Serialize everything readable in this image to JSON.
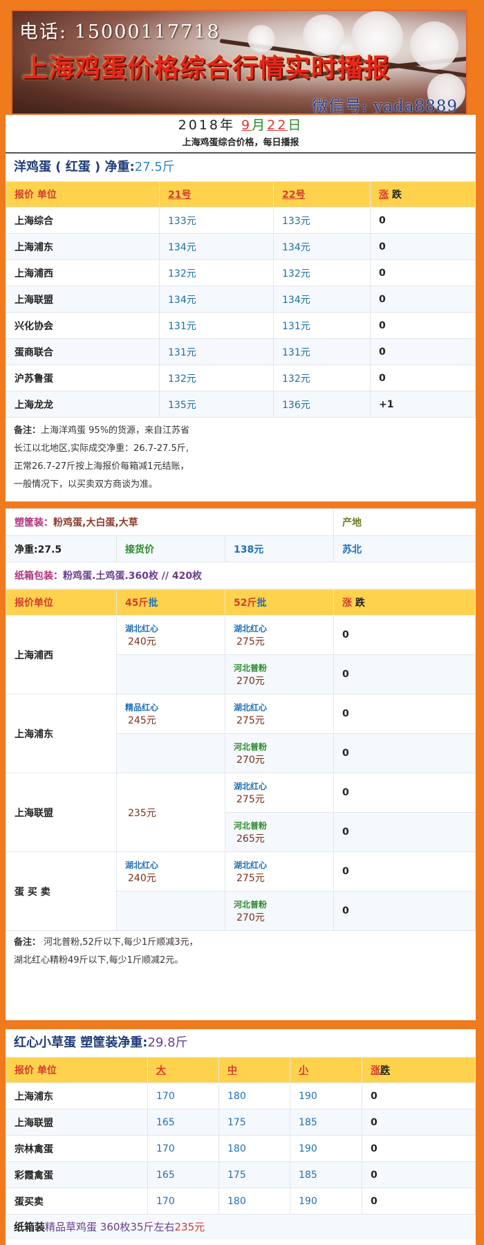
{
  "banner": {
    "phone": "电话: 15000117718",
    "title": "上海鸡蛋价格综合行情实时播报",
    "wechat": "微信号: yada8889"
  },
  "date": {
    "year": "2018",
    "year_unit": "年",
    "month": "9",
    "month_unit": "月",
    "day": "22",
    "day_unit": "日"
  },
  "subtitle": "上海鸡蛋综合价格，每日播报",
  "section1": {
    "title": "洋鸡蛋 ( 红蛋 ) 净重:",
    "weight": "27.5斤",
    "header": {
      "col1": "报价 单位",
      "col2": "21号",
      "col3": "22号",
      "col4a": "涨",
      "col4b": "跌"
    },
    "rows": [
      {
        "name": "上海综合",
        "d21": "133元",
        "d22": "133元",
        "chg": "0"
      },
      {
        "name": "上海浦东",
        "d21": "134元",
        "d22": "134元",
        "chg": "0"
      },
      {
        "name": "上海浦西",
        "d21": "132元",
        "d22": "132元",
        "chg": "0"
      },
      {
        "name": "上海联盟",
        "d21": "134元",
        "d22": "134元",
        "chg": "0"
      },
      {
        "name": "兴化协会",
        "d21": "131元",
        "d22": "131元",
        "chg": "0"
      },
      {
        "name": "蛋商联合",
        "d21": "131元",
        "d22": "131元",
        "chg": "0"
      },
      {
        "name": "沪苏鲁蛋",
        "d21": "132元",
        "d22": "132元",
        "chg": "0"
      },
      {
        "name": "上海龙龙",
        "d21": "135元",
        "d22": "136元",
        "chg": "+1"
      }
    ],
    "note_label": "备注：",
    "note_lines": [
      "上海洋鸡蛋 95%的货源，来自江苏省",
      "长江以北地区,实际成交净重：26.7-27.5斤,",
      "正常26.7-27斤按上海报价每箱减1元结账，",
      "一般情况下，以买卖双方商谈为准。"
    ]
  },
  "section2": {
    "label": "塑筐装：",
    "desc": "粉鸡蛋,大白蛋,大草",
    "origin_label": "产地",
    "weight": "净重:27.5",
    "price_label": "接货价",
    "price": "138元",
    "origin": "苏北",
    "carton_label": "纸箱包装：",
    "carton_desc": "粉鸡蛋.土鸡蛋.360枚 // 420枚",
    "header": {
      "col1": "报价单位",
      "col2": "45斤",
      "col2b": "批",
      "col3": "52斤",
      "col3b": "批",
      "col4a": "涨",
      "col4b": "跌"
    },
    "groups": [
      {
        "name": "上海浦西",
        "a_tag": "湖北红心",
        "a_price": "240元",
        "b1_tag": "湖北红心",
        "b1_price": "275元",
        "c1": "0",
        "b2_tag": "河北普粉",
        "b2_price": "270元",
        "c2": "0"
      },
      {
        "name": "上海浦东",
        "a_tag": "精品红心",
        "a_price": "245元",
        "b1_tag": "湖北红心",
        "b1_price": "275元",
        "c1": "0",
        "b2_tag": "河北普粉",
        "b2_price": "270元",
        "c2": "0"
      },
      {
        "name": "上海联盟",
        "a_tag": "",
        "a_price": "235元",
        "b1_tag": "湖北红心",
        "b1_price": "275元",
        "c1": "0",
        "b2_tag": "河北普粉",
        "b2_price": "265元",
        "c2": "0"
      },
      {
        "name": "蛋 买 卖",
        "a_tag": "湖北红心",
        "a_price": "240元",
        "b1_tag": "湖北红心",
        "b1_price": "275元",
        "c1": "0",
        "b2_tag": "河北普粉",
        "b2_price": "270元",
        "c2": "0"
      }
    ],
    "note_label": "备注：",
    "note_lines": [
      " 河北普粉,52斤以下,每少1斤顺减3元，",
      " 湖北红心精粉49斤以下,每少1斤顺减2元。"
    ]
  },
  "section3": {
    "title": "红心小草蛋 塑筐装净重:",
    "weight": "29.8斤",
    "header": {
      "col1": "报价 单位",
      "col2": "大",
      "col3": "中",
      "col4": "小",
      "col5a": "涨",
      "col5b": "跌"
    },
    "rows": [
      {
        "name": "上海浦东",
        "big": "170",
        "mid": "180",
        "small": "190",
        "chg": "0"
      },
      {
        "name": "上海联盟",
        "big": "165",
        "mid": "175",
        "small": "185",
        "chg": "0"
      },
      {
        "name": "宗林禽蛋",
        "big": "170",
        "mid": "180",
        "small": "190",
        "chg": "0"
      },
      {
        "name": "彩霞禽蛋",
        "big": "165",
        "mid": "175",
        "small": "185",
        "chg": "0"
      },
      {
        "name": "蛋买卖",
        "big": "170",
        "mid": "180",
        "small": "190",
        "chg": "0"
      }
    ],
    "footer_label": "纸箱装",
    "footer_desc": "精品草鸡蛋 360枚35斤左右",
    "footer_price": "235元"
  }
}
